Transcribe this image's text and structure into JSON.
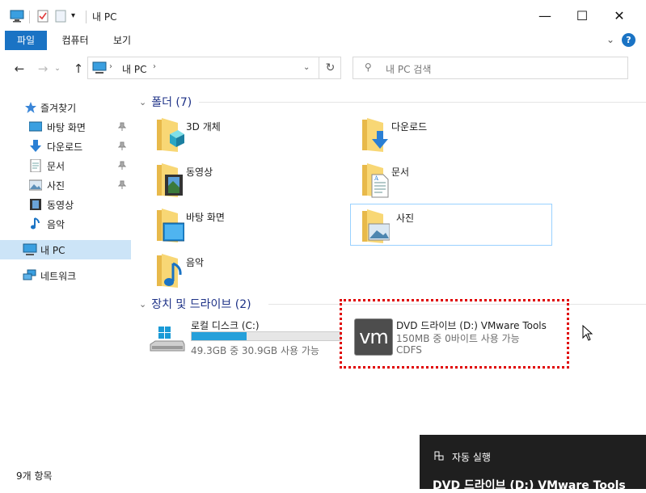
{
  "window": {
    "title": "내 PC",
    "controls": {
      "minimize": "—",
      "maximize": "☐",
      "close": "✕"
    }
  },
  "ribbon": {
    "tabs": [
      {
        "label": "파일",
        "active": true
      },
      {
        "label": "컴퓨터",
        "active": false
      },
      {
        "label": "보기",
        "active": false
      }
    ],
    "help": "?"
  },
  "nav": {
    "breadcrumb": [
      "내 PC"
    ],
    "search_placeholder": "내 PC 검색"
  },
  "sidebar": {
    "items": [
      {
        "label": "즐겨찾기",
        "icon": "star-icon"
      },
      {
        "label": "바탕 화면",
        "icon": "desktop-icon",
        "pinned": true
      },
      {
        "label": "다운로드",
        "icon": "download-icon",
        "pinned": true
      },
      {
        "label": "문서",
        "icon": "document-icon",
        "pinned": true
      },
      {
        "label": "사진",
        "icon": "picture-icon",
        "pinned": true
      },
      {
        "label": "동영상",
        "icon": "video-icon"
      },
      {
        "label": "음악",
        "icon": "music-icon"
      },
      {
        "label": "내 PC",
        "icon": "computer-icon",
        "selected": true
      },
      {
        "label": "네트워크",
        "icon": "network-icon"
      }
    ]
  },
  "folders": {
    "header": "폴더 (7)",
    "items": [
      {
        "label": "3D 개체",
        "icon": "3d-objects-icon"
      },
      {
        "label": "다운로드",
        "icon": "download-folder-icon"
      },
      {
        "label": "동영상",
        "icon": "video-folder-icon"
      },
      {
        "label": "문서",
        "icon": "document-folder-icon"
      },
      {
        "label": "바탕 화면",
        "icon": "desktop-folder-icon"
      },
      {
        "label": "사진",
        "icon": "picture-folder-icon"
      },
      {
        "label": "음악",
        "icon": "music-folder-icon"
      }
    ]
  },
  "drives": {
    "header": "장치 및 드라이브 (2)",
    "items": [
      {
        "label": "로컬 디스크 (C:)",
        "detail": "49.3GB 중 30.9GB 사용 가능",
        "used_fraction": 0.37,
        "icon": "windows-drive-icon"
      },
      {
        "label": "DVD 드라이브 (D:) VMware Tools",
        "detail": "150MB 중 0바이트 사용 가능",
        "filesystem": "CDFS",
        "icon": "vm-icon-text",
        "icon_text": "vm"
      }
    ]
  },
  "status": {
    "count": "9개 항목"
  },
  "toast": {
    "action": "자동 실행",
    "title": "DVD 드라이브 (D:) VMware Tools"
  },
  "colors": {
    "accent": "#1a73c4",
    "folder": "#f8d775",
    "drive_bar": "#26a0da",
    "highlight": "#e00000"
  }
}
